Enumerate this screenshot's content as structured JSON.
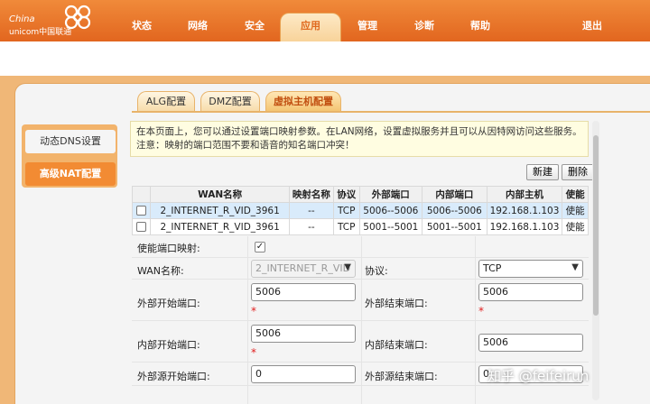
{
  "header": {
    "logo_line1": "China",
    "logo_line2": "unicom中国联通",
    "nav": [
      {
        "label": "状态"
      },
      {
        "label": "网络"
      },
      {
        "label": "安全"
      },
      {
        "label": "应用"
      },
      {
        "label": "管理"
      },
      {
        "label": "诊断"
      },
      {
        "label": "帮助"
      }
    ],
    "active_nav": "应用",
    "logout": "退出"
  },
  "tabs": [
    {
      "label": "ALG配置"
    },
    {
      "label": "DMZ配置"
    },
    {
      "label": "虚拟主机配置"
    }
  ],
  "sidebar": {
    "items": [
      {
        "label": "动态DNS设置"
      },
      {
        "label": "高级NAT配置"
      }
    ]
  },
  "info": {
    "line1": "在本页面上，您可以通过设置端口映射参数。在LAN网络，设置虚拟服务并且可以从因特网访问这些服务。",
    "line2": "注意：映射的端口范围不要和语音的知名端口冲突！"
  },
  "toolbar": {
    "new_label": "新建",
    "delete_label": "删除"
  },
  "table": {
    "headers": [
      "",
      "WAN名称",
      "映射名称",
      "协议",
      "外部端口",
      "内部端口",
      "内部主机",
      "使能"
    ],
    "rows": [
      {
        "wan": "2_INTERNET_R_VID_3961",
        "map": "--",
        "proto": "TCP",
        "ext": "5006--5006",
        "int": "5006--5006",
        "host": "192.168.1.103",
        "enable": "使能"
      },
      {
        "wan": "2_INTERNET_R_VID_3961",
        "map": "--",
        "proto": "TCP",
        "ext": "5001--5001",
        "int": "5001--5001",
        "host": "192.168.1.103",
        "enable": "使能"
      }
    ]
  },
  "form": {
    "enable_label": "使能端口映射:",
    "wan_label": "WAN名称:",
    "wan_value": "2_INTERNET_R_VID",
    "proto_label": "协议:",
    "proto_value": "TCP",
    "ext_start_label": "外部开始端口:",
    "ext_start_value": "5006",
    "ext_end_label": "外部结束端口:",
    "ext_end_value": "5006",
    "int_start_label": "内部开始端口:",
    "int_start_value": "5006",
    "int_end_label": "内部结束端口:",
    "int_end_value": "5006",
    "src_start_label": "外部源开始端口:",
    "src_start_value": "0",
    "src_end_label": "外部源结束端口:",
    "src_end_value": "0",
    "required_mark": "*"
  },
  "watermark": "知乎 @feifeirun",
  "colors": {
    "header_orange": "#e8732a",
    "frame_orange": "#f0b777",
    "active_side": "#f28b33",
    "selected_row": "#d9ebfb",
    "info_bg": "#fffde1"
  }
}
